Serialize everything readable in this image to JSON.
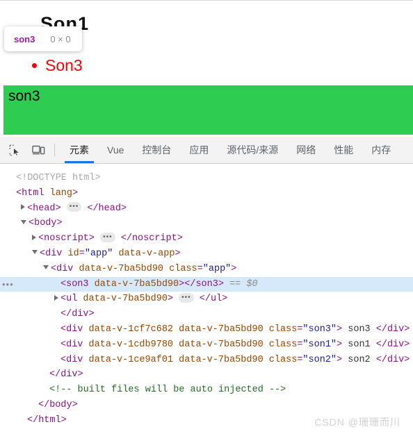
{
  "page_preview": {
    "obscured_heading": "Son1",
    "bullet_item": "Son3",
    "highlight": {
      "label": "son3",
      "color": "#2ecc50"
    },
    "tooltip": {
      "tag_name": "son3",
      "dimensions": "0 × 0"
    }
  },
  "devtools": {
    "toolbar": {
      "inspect_icon": "inspect-element-icon",
      "device_icon": "device-toolbar-icon"
    },
    "tabs": [
      {
        "label": "元素",
        "active": true
      },
      {
        "label": "Vue",
        "active": false
      },
      {
        "label": "控制台",
        "active": false
      },
      {
        "label": "应用",
        "active": false
      },
      {
        "label": "源代码/来源",
        "active": false
      },
      {
        "label": "网络",
        "active": false
      },
      {
        "label": "性能",
        "active": false
      },
      {
        "label": "内存",
        "active": false
      }
    ],
    "accent_color": "#1a73e8",
    "dom_tree": {
      "rows": [
        {
          "indent": 0,
          "twisty": "none",
          "selected": false,
          "tokens": [
            {
              "t": "doctype",
              "v": "<!DOCTYPE html>"
            }
          ]
        },
        {
          "indent": 0,
          "twisty": "none",
          "selected": false,
          "tokens": [
            {
              "t": "tag",
              "v": "<html "
            },
            {
              "t": "attr",
              "v": "lang"
            },
            {
              "t": "tag",
              "v": ">"
            }
          ]
        },
        {
          "indent": 1,
          "twisty": "closed",
          "selected": false,
          "tokens": [
            {
              "t": "tag",
              "v": "<head>"
            },
            {
              "t": "badge",
              "v": "…"
            },
            {
              "t": "tag",
              "v": "</head>"
            }
          ]
        },
        {
          "indent": 1,
          "twisty": "open",
          "selected": false,
          "tokens": [
            {
              "t": "tag",
              "v": "<body>"
            }
          ]
        },
        {
          "indent": 2,
          "twisty": "closed",
          "selected": false,
          "tokens": [
            {
              "t": "tag",
              "v": "<noscript>"
            },
            {
              "t": "badge",
              "v": "…"
            },
            {
              "t": "tag",
              "v": "</noscript>"
            }
          ]
        },
        {
          "indent": 2,
          "twisty": "open",
          "selected": false,
          "tokens": [
            {
              "t": "tag",
              "v": "<div "
            },
            {
              "t": "attr",
              "v": "id"
            },
            {
              "t": "tag",
              "v": "="
            },
            {
              "t": "value",
              "v": "\"app\""
            },
            {
              "t": "tag",
              "v": " "
            },
            {
              "t": "attr",
              "v": "data-v-app"
            },
            {
              "t": "tag",
              "v": ">"
            }
          ]
        },
        {
          "indent": 3,
          "twisty": "open",
          "selected": false,
          "tokens": [
            {
              "t": "tag",
              "v": "<div "
            },
            {
              "t": "attr",
              "v": "data-v-7ba5bd90"
            },
            {
              "t": "tag",
              "v": " "
            },
            {
              "t": "attr",
              "v": "class"
            },
            {
              "t": "tag",
              "v": "="
            },
            {
              "t": "value",
              "v": "\"app\""
            },
            {
              "t": "tag",
              "v": ">"
            }
          ]
        },
        {
          "indent": 4,
          "twisty": "none",
          "selected": true,
          "dots": true,
          "tokens": [
            {
              "t": "tag",
              "v": "<son3 "
            },
            {
              "t": "attr",
              "v": "data-v-7ba5bd90"
            },
            {
              "t": "tag",
              "v": "></son3>"
            },
            {
              "t": "dollar",
              "v": " == $0"
            }
          ]
        },
        {
          "indent": 4,
          "twisty": "closed",
          "selected": false,
          "tokens": [
            {
              "t": "tag",
              "v": "<ul "
            },
            {
              "t": "attr",
              "v": "data-v-7ba5bd90"
            },
            {
              "t": "tag",
              "v": ">"
            },
            {
              "t": "badge",
              "v": "…"
            },
            {
              "t": "tag",
              "v": "</ul>"
            }
          ]
        },
        {
          "indent": 4,
          "twisty": "none",
          "selected": false,
          "tokens": [
            {
              "t": "tag",
              "v": "</div>"
            }
          ]
        },
        {
          "indent": 4,
          "twisty": "none",
          "selected": false,
          "tokens": [
            {
              "t": "tag",
              "v": "<div "
            },
            {
              "t": "attr",
              "v": "data-v-1cf7c682"
            },
            {
              "t": "tag",
              "v": " "
            },
            {
              "t": "attr",
              "v": "data-v-7ba5bd90"
            },
            {
              "t": "tag",
              "v": " "
            },
            {
              "t": "attr",
              "v": "class"
            },
            {
              "t": "tag",
              "v": "="
            },
            {
              "t": "value",
              "v": "\"son3\""
            },
            {
              "t": "tag",
              "v": ">"
            },
            {
              "t": "text",
              "v": " son3 "
            },
            {
              "t": "tag",
              "v": "</div>"
            }
          ]
        },
        {
          "indent": 4,
          "twisty": "none",
          "selected": false,
          "tokens": [
            {
              "t": "tag",
              "v": "<div "
            },
            {
              "t": "attr",
              "v": "data-v-1cdb9780"
            },
            {
              "t": "tag",
              "v": " "
            },
            {
              "t": "attr",
              "v": "data-v-7ba5bd90"
            },
            {
              "t": "tag",
              "v": " "
            },
            {
              "t": "attr",
              "v": "class"
            },
            {
              "t": "tag",
              "v": "="
            },
            {
              "t": "value",
              "v": "\"son1\""
            },
            {
              "t": "tag",
              "v": ">"
            },
            {
              "t": "text",
              "v": " son1 "
            },
            {
              "t": "tag",
              "v": "</div>"
            }
          ]
        },
        {
          "indent": 4,
          "twisty": "none",
          "selected": false,
          "tokens": [
            {
              "t": "tag",
              "v": "<div "
            },
            {
              "t": "attr",
              "v": "data-v-1ce9af01"
            },
            {
              "t": "tag",
              "v": " "
            },
            {
              "t": "attr",
              "v": "data-v-7ba5bd90"
            },
            {
              "t": "tag",
              "v": " "
            },
            {
              "t": "attr",
              "v": "class"
            },
            {
              "t": "tag",
              "v": "="
            },
            {
              "t": "value",
              "v": "\"son2\""
            },
            {
              "t": "tag",
              "v": ">"
            },
            {
              "t": "text",
              "v": " son2 "
            },
            {
              "t": "tag",
              "v": "</div>"
            }
          ]
        },
        {
          "indent": 3,
          "twisty": "none",
          "selected": false,
          "tokens": [
            {
              "t": "tag",
              "v": "</div>"
            }
          ]
        },
        {
          "indent": 3,
          "twisty": "none",
          "selected": false,
          "tokens": [
            {
              "t": "comment",
              "v": "<!-- built files will be auto injected -->"
            }
          ]
        },
        {
          "indent": 2,
          "twisty": "none",
          "selected": false,
          "tokens": [
            {
              "t": "tag",
              "v": "</body>"
            }
          ]
        },
        {
          "indent": 1,
          "twisty": "none",
          "selected": false,
          "tokens": [
            {
              "t": "tag",
              "v": "</html>"
            }
          ]
        }
      ]
    }
  },
  "watermark": "CSDN @珊珊而川"
}
